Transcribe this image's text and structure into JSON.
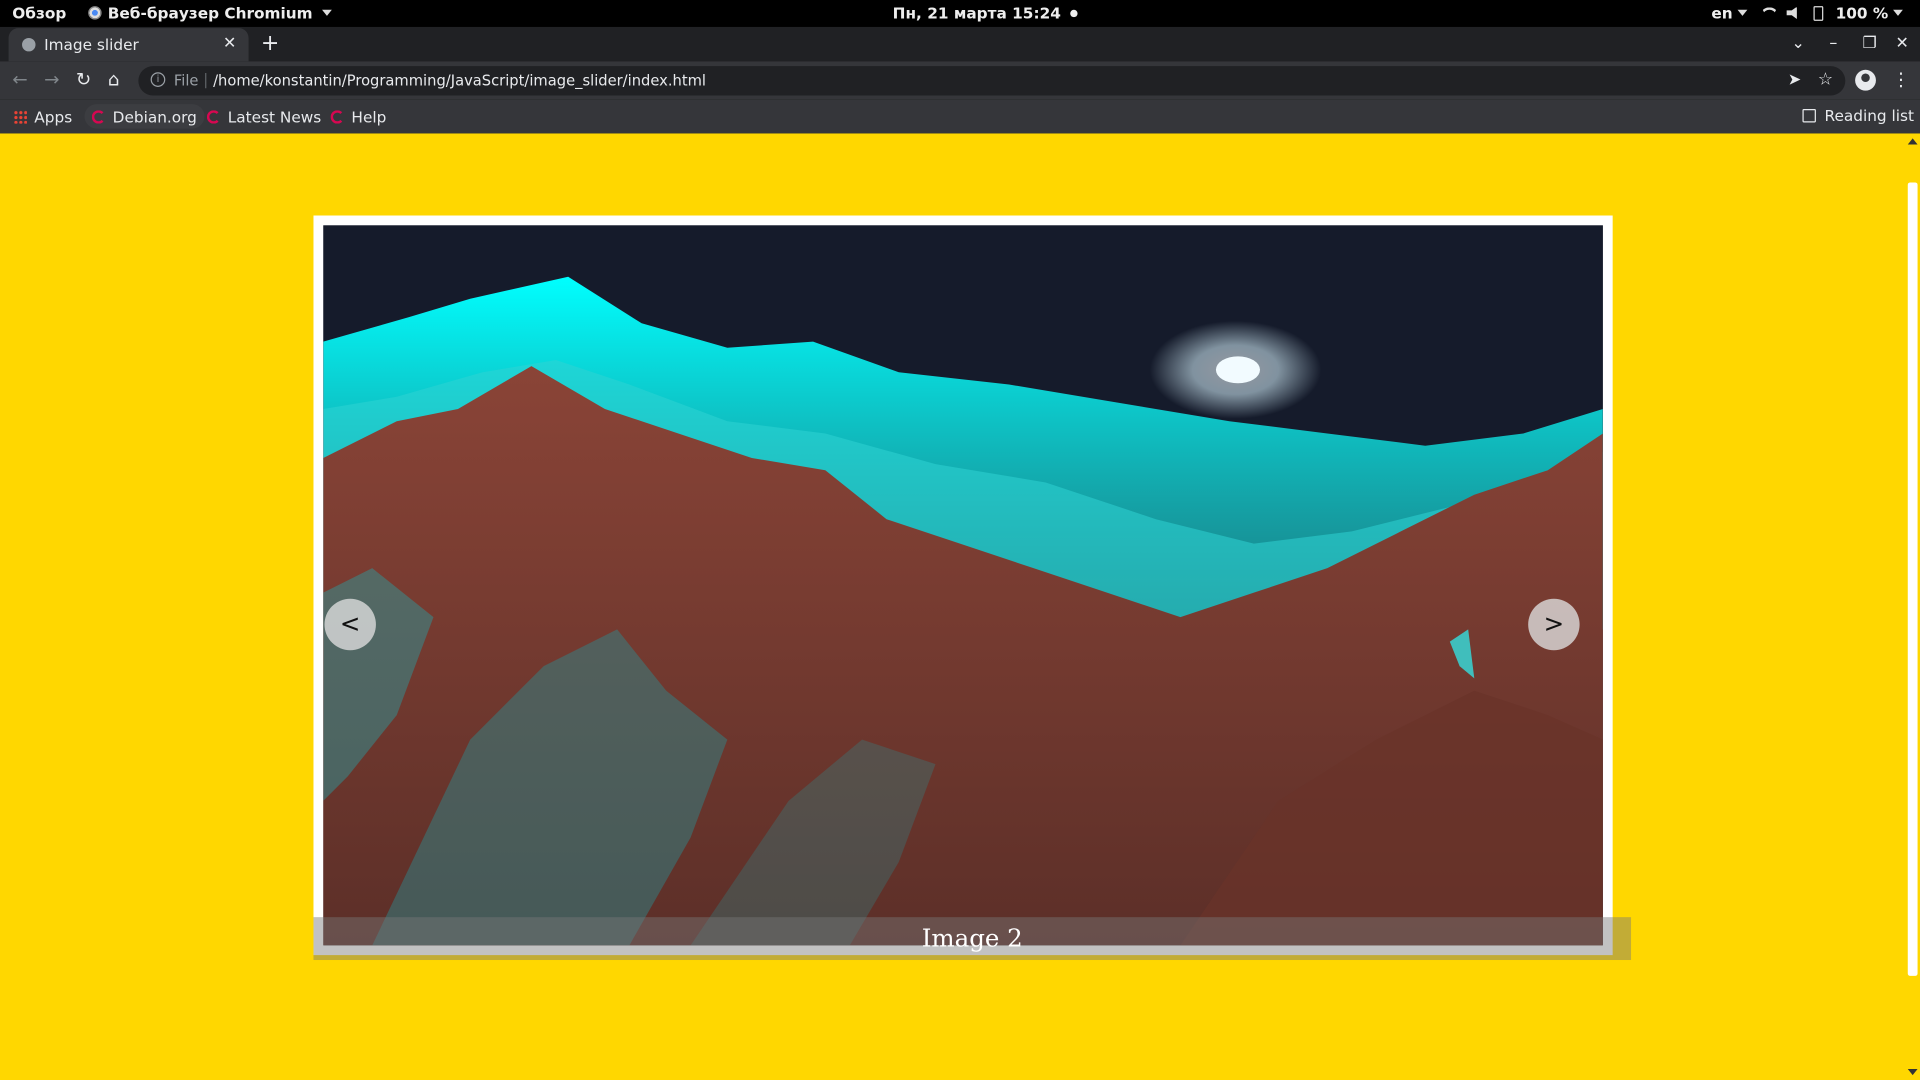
{
  "system_bar": {
    "overview": "Обзор",
    "app_name": "Веб-браузер Chromium",
    "clock": "Пн, 21 марта  15:24",
    "keyboard_layout": "en",
    "battery": "100 %"
  },
  "browser": {
    "tab_title": "Image slider",
    "address_scheme": "File",
    "address_url": "/home/konstantin/Programming/JavaScript/image_slider/index.html",
    "bookmarks": [
      {
        "label": "Apps"
      },
      {
        "label": "Debian.org"
      },
      {
        "label": "Latest News"
      },
      {
        "label": "Help"
      }
    ],
    "reading_list": "Reading list"
  },
  "page": {
    "background_color": "#ffd700",
    "slider": {
      "caption": "Image 2",
      "prev_label": "<",
      "next_label": ">"
    }
  }
}
